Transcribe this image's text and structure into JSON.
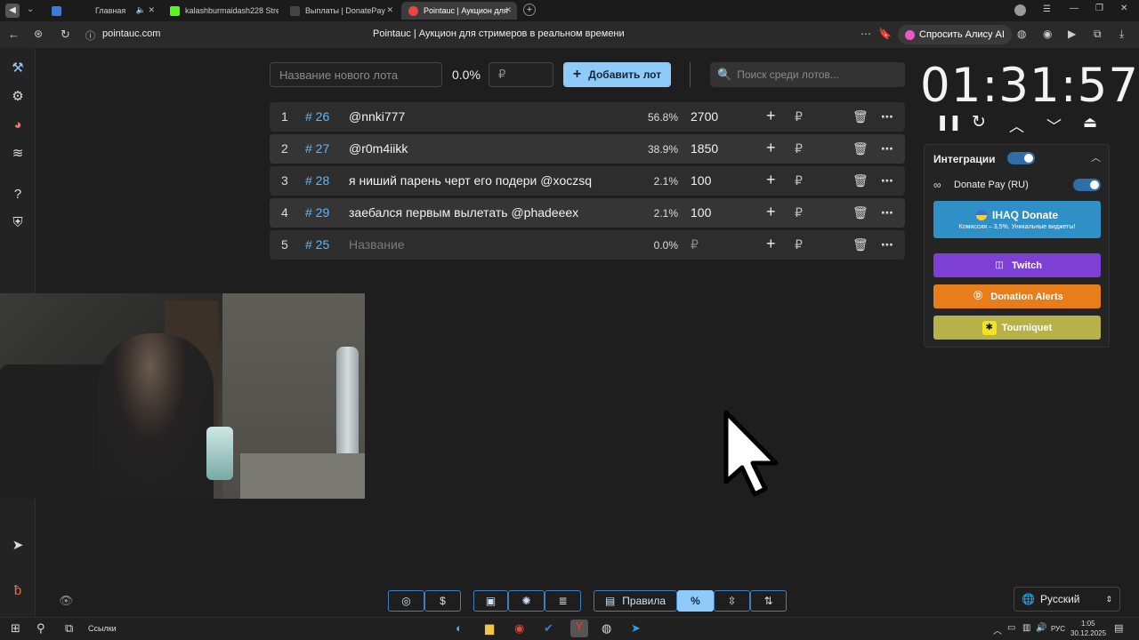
{
  "browser": {
    "tabs": [
      {
        "title": "Главная",
        "color": "#3a7bd5"
      },
      {
        "title": "kalashburmaidash228 Stre",
        "color": "#53fc18"
      },
      {
        "title": "Выплаты | DonatePay",
        "color": "#444"
      },
      {
        "title": "Pointauc | Аукцион для",
        "color": "#e44"
      }
    ],
    "url": "pointauc.com",
    "page_title": "Pointauc | Аукцион для стримеров в реальном времени",
    "alice_label": "Спросить Алису AI"
  },
  "toolbar": {
    "new_lot_placeholder": "Название нового лота",
    "percent": "0.0%",
    "currency_placeholder": "₽",
    "add_lot_label": "Добавить лот",
    "search_placeholder": "Поиск среди лотов..."
  },
  "lots": [
    {
      "num": "1",
      "id": "# 26",
      "name": "@nnki777",
      "pct": "56.8%",
      "amount": "2700"
    },
    {
      "num": "2",
      "id": "# 27",
      "name": "@r0m4iikk",
      "pct": "38.9%",
      "amount": "1850"
    },
    {
      "num": "3",
      "id": "# 28",
      "name": "я ниший парень черт его подери @xoczsq",
      "pct": "2.1%",
      "amount": "100"
    },
    {
      "num": "4",
      "id": "# 29",
      "name": "заебался первым вылетать @phadeeex",
      "pct": "2.1%",
      "amount": "100"
    },
    {
      "num": "5",
      "id": "# 25",
      "name": "Название",
      "pct": "0.0%",
      "amount": "₽"
    }
  ],
  "lot_currency": "₽",
  "timer": "01:31:57",
  "integrations": {
    "title": "Интеграции",
    "donatepay_label": "Donate Pay (RU)",
    "ihaq_title": "IHAQ Donate",
    "ihaq_sub": "Комиссия – 3,5%. Уникальные виджеты!",
    "twitch": "Twitch",
    "donation_alerts": "Donation Alerts",
    "tourniquet": "Tourniquet"
  },
  "bottom": {
    "rules_label": "Правила",
    "percent_symbol": "%",
    "dollar_symbol": "$",
    "language": "Русский"
  },
  "taskbar": {
    "links_label": "Ссылки",
    "lang": "РУС",
    "time": "1:05",
    "date": "30.12.2025"
  }
}
